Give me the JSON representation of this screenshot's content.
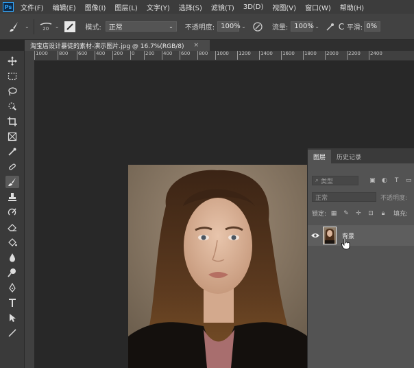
{
  "app": {
    "logo": "Ps"
  },
  "menu": [
    "文件(F)",
    "编辑(E)",
    "图像(I)",
    "图层(L)",
    "文字(Y)",
    "选择(S)",
    "滤镜(T)",
    "3D(D)",
    "视图(V)",
    "窗口(W)",
    "帮助(H)"
  ],
  "options": {
    "brush_size": "20",
    "mode_label": "模式:",
    "mode_value": "正常",
    "opacity_label": "不透明度:",
    "opacity_value": "100%",
    "flow_label": "流量:",
    "flow_value": "100%",
    "smoothing_label": "平滑:",
    "smoothing_value": "0%"
  },
  "document": {
    "tab_title": "淘宝店设计暴徒的素材-演示图片.jpg @ 16.7%(RGB/8)",
    "close": "×"
  },
  "ruler_top": [
    "1000",
    "800",
    "600",
    "400",
    "200",
    "0",
    "200",
    "400",
    "600",
    "800",
    "1000",
    "1200",
    "1400",
    "1600",
    "1800",
    "2000",
    "2200",
    "2400"
  ],
  "tools": [
    "move-icon",
    "marquee-icon",
    "lasso-icon",
    "quick-select-icon",
    "crop-icon",
    "frame-icon",
    "eyedropper-icon",
    "healing-icon",
    "brush-icon",
    "stamp-icon",
    "history-brush-icon",
    "eraser-icon",
    "bucket-icon",
    "blur-icon",
    "dodge-icon",
    "pen-icon",
    "type-icon",
    "path-select-icon",
    "line-icon"
  ],
  "layers_panel": {
    "tabs": [
      "图层",
      "历史记录"
    ],
    "filter_kind": "类型",
    "blend_mode": "正常",
    "opacity_label": "不透明度:",
    "lock_label": "锁定:",
    "fill_label": "填充:",
    "layers": [
      {
        "name": "背景"
      }
    ]
  },
  "colors": {
    "accent": "#31a8ff",
    "panel": "#535353",
    "canvas": "#282828"
  }
}
